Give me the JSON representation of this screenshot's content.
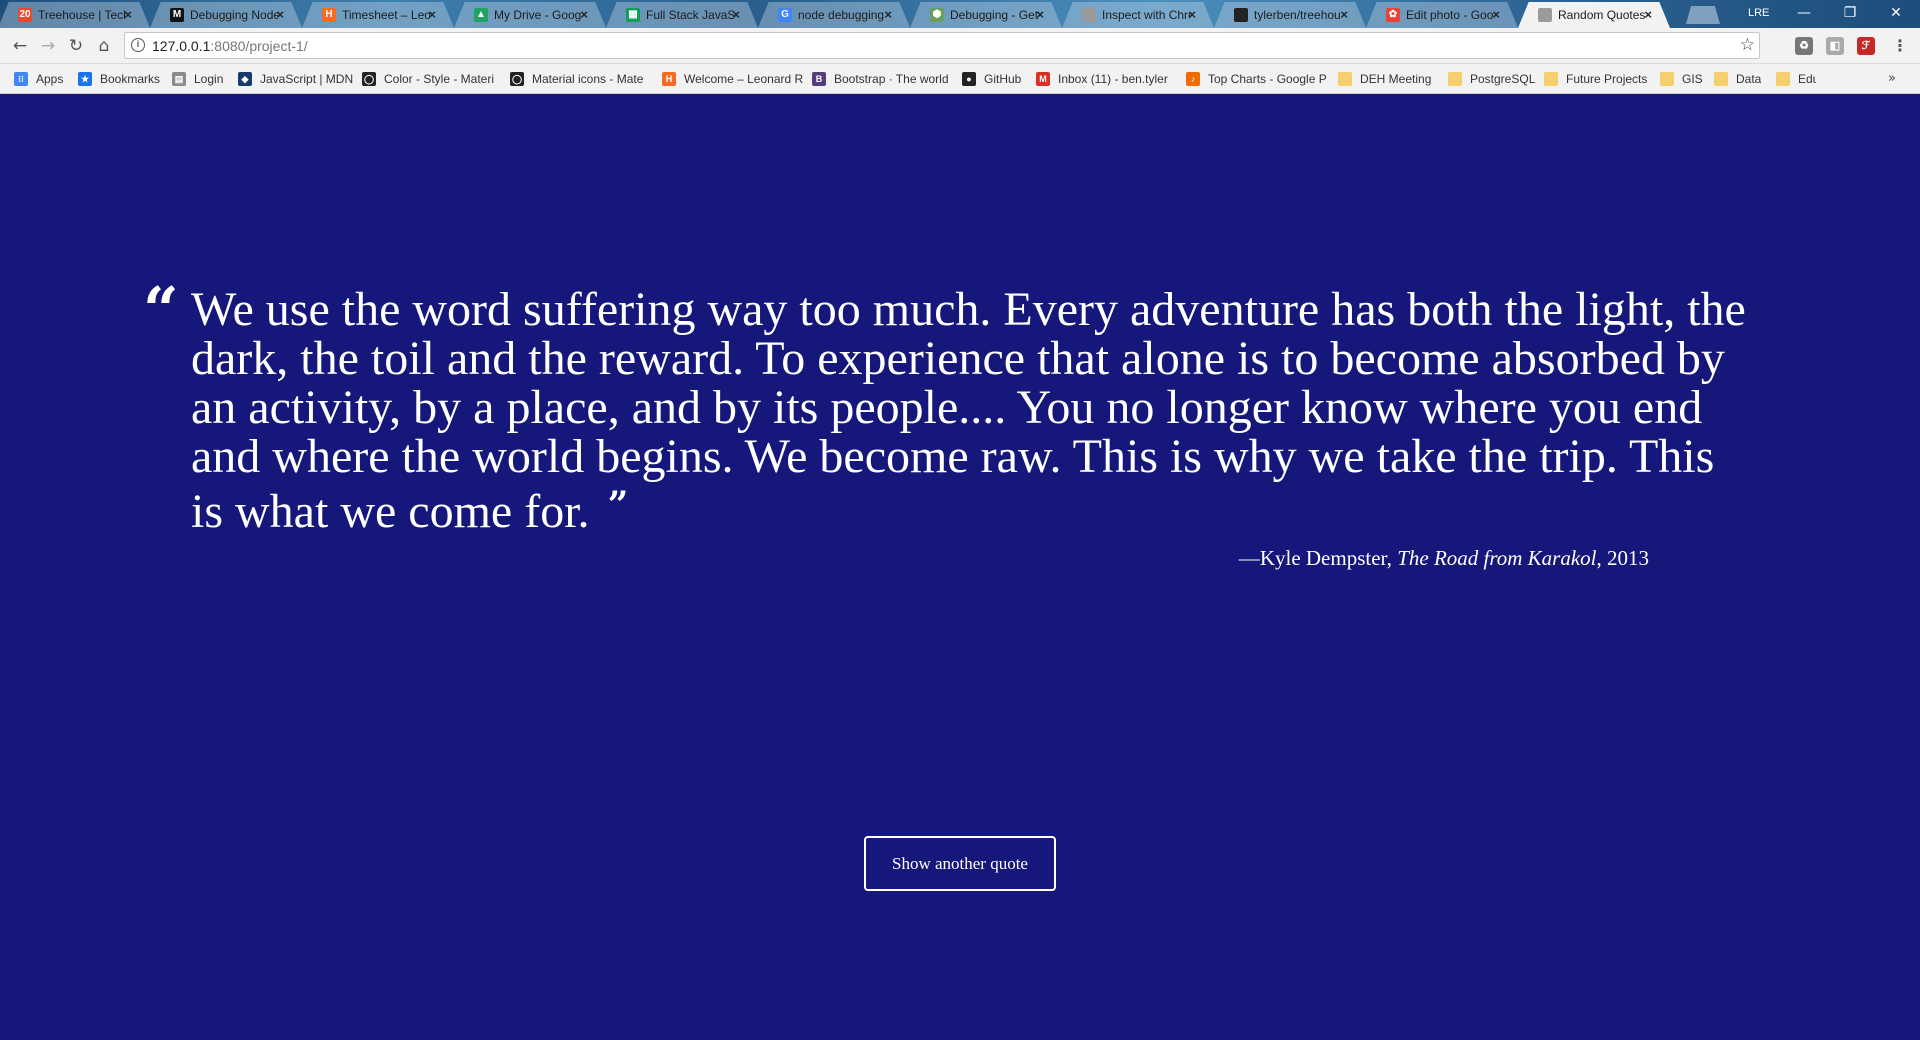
{
  "browser": {
    "tabs": [
      {
        "title": "Treehouse | Techn",
        "icon": "treehouse-icon",
        "badge": "20",
        "color": "#e84a2f"
      },
      {
        "title": "Debugging Node",
        "icon": "medium-icon",
        "badge": "M",
        "color": "#111111"
      },
      {
        "title": "Timesheet – Leon",
        "icon": "harvest-icon",
        "badge": "H",
        "color": "#f36c21"
      },
      {
        "title": "My Drive - Googl",
        "icon": "drive-icon",
        "badge": "▲",
        "color": "#1fa463"
      },
      {
        "title": "Full Stack JavaScr",
        "icon": "sheets-icon",
        "badge": "▦",
        "color": "#0f9d58"
      },
      {
        "title": "node debugging",
        "icon": "google-icon",
        "badge": "G",
        "color": "#4285f4"
      },
      {
        "title": "Debugging - Get",
        "icon": "nodejs-icon",
        "badge": "⬢",
        "color": "#68a063"
      },
      {
        "title": "Inspect with Chro",
        "icon": "page-icon",
        "badge": "",
        "color": "#9a9a9a"
      },
      {
        "title": "tylerben/treehou",
        "icon": "github-icon",
        "badge": "",
        "color": "#222222"
      },
      {
        "title": "Edit photo - Goo",
        "icon": "photos-icon",
        "badge": "✿",
        "color": "#ea4335"
      },
      {
        "title": "Random Quotes",
        "icon": "page-icon",
        "badge": "",
        "color": "#9a9a9a",
        "active": true
      }
    ],
    "profile": "LRE",
    "window_controls": {
      "minimize": "—",
      "restore": "❐",
      "close": "✕"
    },
    "url_host": "127.0.0.1",
    "url_path": ":8080/project-1/",
    "bookmarks": [
      {
        "label": "Apps",
        "icon": "apps-icon",
        "color": "#4285f4",
        "glyph": "⁝⁝"
      },
      {
        "label": "Bookmarks",
        "icon": "star-icon",
        "color": "#1a73e8",
        "glyph": "★"
      },
      {
        "label": "Login",
        "icon": "login-icon",
        "color": "#8a8a8a",
        "glyph": "▤"
      },
      {
        "label": "JavaScript | MDN",
        "icon": "mdn-icon",
        "color": "#1a3b6e",
        "glyph": "◆"
      },
      {
        "label": "Color - Style - Materi",
        "icon": "material-icon",
        "color": "#222222",
        "glyph": "◯"
      },
      {
        "label": "Material icons - Mate",
        "icon": "material-icon",
        "color": "#222222",
        "glyph": "◯"
      },
      {
        "label": "Welcome – Leonard R",
        "icon": "harvest-icon",
        "color": "#f36c21",
        "glyph": "H"
      },
      {
        "label": "Bootstrap · The world",
        "icon": "bootstrap-icon",
        "color": "#563d7c",
        "glyph": "B"
      },
      {
        "label": "GitHub",
        "icon": "github-icon",
        "color": "#222222",
        "glyph": "●"
      },
      {
        "label": "Inbox (11) - ben.tyler",
        "icon": "gmail-icon",
        "color": "#d93025",
        "glyph": "M"
      },
      {
        "label": "Top Charts - Google P",
        "icon": "music-icon",
        "color": "#ef6c00",
        "glyph": "♪"
      },
      {
        "label": "DEH Meeting",
        "icon": "folder-icon",
        "color": "#f5cf6e",
        "glyph": ""
      },
      {
        "label": "PostgreSQL",
        "icon": "folder-icon",
        "color": "#f5cf6e",
        "glyph": ""
      },
      {
        "label": "Future Projects",
        "icon": "folder-icon",
        "color": "#f5cf6e",
        "glyph": ""
      },
      {
        "label": "GIS",
        "icon": "folder-icon",
        "color": "#f5cf6e",
        "glyph": ""
      },
      {
        "label": "Data",
        "icon": "folder-icon",
        "color": "#f5cf6e",
        "glyph": ""
      },
      {
        "label": "Edu",
        "icon": "folder-icon",
        "color": "#f5cf6e",
        "glyph": ""
      }
    ],
    "bookmarks_overflow": "»"
  },
  "page": {
    "background": "#15187a",
    "quote_open": "“",
    "quote": "We use the word suffering way too much. Every adventure has both the light, the dark, the toil and the reward. To experience that alone is to become absorbed by an activity, by a place, and by its people.... You no longer know where you end and where the world begins. We become raw. This is why we take the trip. This is what we come for.",
    "quote_close": "”",
    "author_prefix": "—Kyle Dempster, ",
    "source": "The Road from Karakol",
    "year_suffix": ", 2013",
    "button_label": "Show another quote"
  }
}
